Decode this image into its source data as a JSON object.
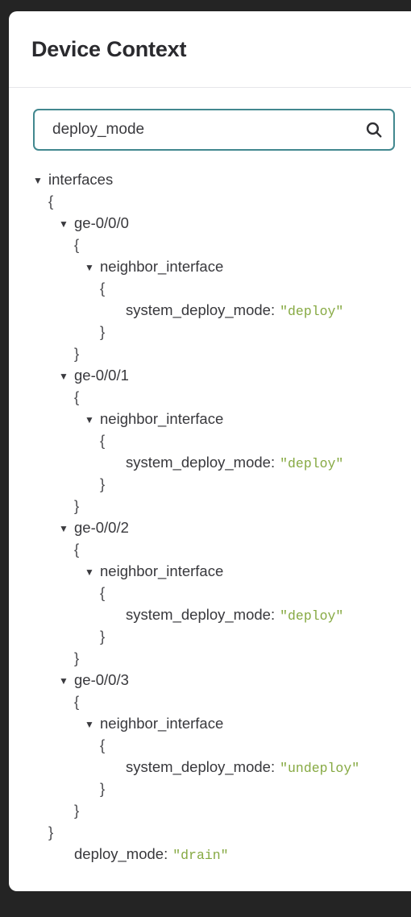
{
  "panel": {
    "title": "Device Context"
  },
  "search": {
    "value": "deploy_mode",
    "placeholder": "Search",
    "icon": "search-icon",
    "border_color": "#42888f"
  },
  "colors": {
    "page_background": "#242424",
    "panel_background": "#ffffff",
    "title_text": "#2a2a2e",
    "tree_text": "#38383c",
    "string_value": "#86a942",
    "divider": "#e6e6ea"
  },
  "tree": {
    "caret_glyph": "▼",
    "open_brace": "{",
    "close_brace": "}",
    "rows": [
      {
        "indent": 0,
        "type": "node",
        "caret": true,
        "key": "interfaces"
      },
      {
        "indent": 0,
        "type": "brace",
        "text": "{"
      },
      {
        "indent": 1,
        "type": "node",
        "caret": true,
        "key": "ge-0/0/0"
      },
      {
        "indent": 1,
        "type": "brace",
        "text": "{"
      },
      {
        "indent": 2,
        "type": "node",
        "caret": true,
        "key": "neighbor_interface"
      },
      {
        "indent": 2,
        "type": "brace",
        "text": "{"
      },
      {
        "indent": 3,
        "type": "leaf",
        "key": "system_deploy_mode:",
        "value": "\"deploy\""
      },
      {
        "indent": 2,
        "type": "brace",
        "text": "}"
      },
      {
        "indent": 1,
        "type": "brace",
        "text": "}"
      },
      {
        "indent": 1,
        "type": "node",
        "caret": true,
        "key": "ge-0/0/1"
      },
      {
        "indent": 1,
        "type": "brace",
        "text": "{"
      },
      {
        "indent": 2,
        "type": "node",
        "caret": true,
        "key": "neighbor_interface"
      },
      {
        "indent": 2,
        "type": "brace",
        "text": "{"
      },
      {
        "indent": 3,
        "type": "leaf",
        "key": "system_deploy_mode:",
        "value": "\"deploy\""
      },
      {
        "indent": 2,
        "type": "brace",
        "text": "}"
      },
      {
        "indent": 1,
        "type": "brace",
        "text": "}"
      },
      {
        "indent": 1,
        "type": "node",
        "caret": true,
        "key": "ge-0/0/2"
      },
      {
        "indent": 1,
        "type": "brace",
        "text": "{"
      },
      {
        "indent": 2,
        "type": "node",
        "caret": true,
        "key": "neighbor_interface"
      },
      {
        "indent": 2,
        "type": "brace",
        "text": "{"
      },
      {
        "indent": 3,
        "type": "leaf",
        "key": "system_deploy_mode:",
        "value": "\"deploy\""
      },
      {
        "indent": 2,
        "type": "brace",
        "text": "}"
      },
      {
        "indent": 1,
        "type": "brace",
        "text": "}"
      },
      {
        "indent": 1,
        "type": "node",
        "caret": true,
        "key": "ge-0/0/3"
      },
      {
        "indent": 1,
        "type": "brace",
        "text": "{"
      },
      {
        "indent": 2,
        "type": "node",
        "caret": true,
        "key": "neighbor_interface"
      },
      {
        "indent": 2,
        "type": "brace",
        "text": "{"
      },
      {
        "indent": 3,
        "type": "leaf",
        "key": "system_deploy_mode:",
        "value": "\"undeploy\""
      },
      {
        "indent": 2,
        "type": "brace",
        "text": "}"
      },
      {
        "indent": 1,
        "type": "brace",
        "text": "}"
      },
      {
        "indent": 0,
        "type": "brace",
        "text": "}"
      },
      {
        "indent": 1,
        "type": "leaf",
        "key": "deploy_mode:",
        "value": "\"drain\"",
        "no_caret_spacer": true
      }
    ]
  }
}
